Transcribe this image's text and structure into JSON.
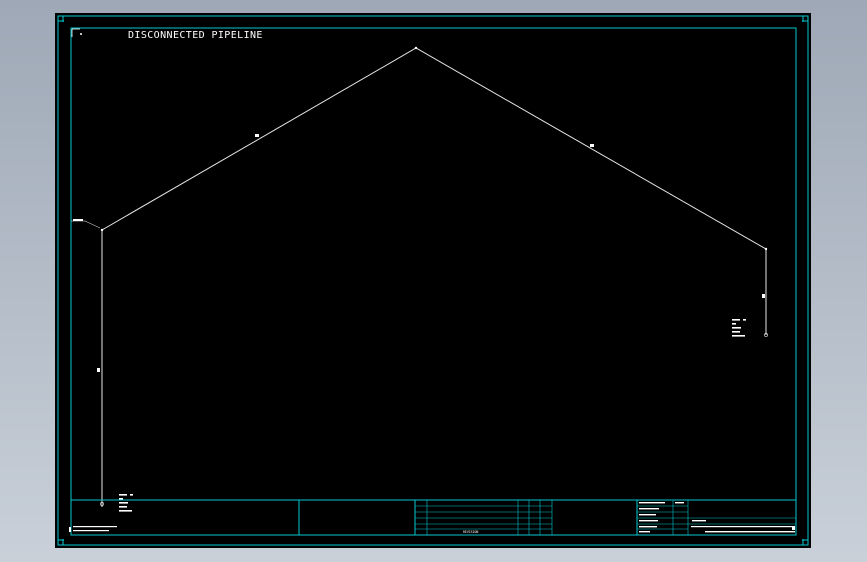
{
  "drawing": {
    "title": "DISCONNECTED PIPELINE"
  },
  "title_block": {
    "revision_header": "REVISION",
    "approvals": [
      "DRAWN BY",
      "CHECKED BY",
      "CHECKED",
      "APPROVED",
      "APPROVED",
      "SCALE"
    ]
  },
  "colors": {
    "sheet_background": "#000000",
    "frame": "#00c8d2",
    "pipeline": "#e6e6e6",
    "text": "#ffffff"
  }
}
